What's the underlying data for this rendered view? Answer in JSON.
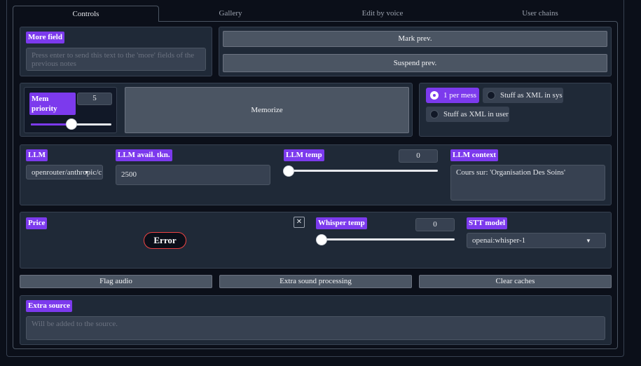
{
  "tabs": [
    "Controls",
    "Gallery",
    "Edit by voice",
    "User chains"
  ],
  "more_field": {
    "label": "More field",
    "placeholder": "Press enter to send this text to the 'more' fields of the previous notes"
  },
  "buttons": {
    "mark_prev": "Mark prev.",
    "suspend_prev": "Suspend prev.",
    "memorize": "Memorize",
    "flag_audio": "Flag audio",
    "extra_sound": "Extra sound processing",
    "clear_caches": "Clear caches"
  },
  "mem_priority": {
    "label": "Mem priority",
    "value": "5",
    "fraction": 0.5
  },
  "message_mode": {
    "options": [
      "1 per mess",
      "Stuff as XML in sys",
      "Stuff as XML in user"
    ],
    "selected": "1 per mess"
  },
  "llm": {
    "label": "LLM",
    "value": "openrouter/anthropic/c"
  },
  "llm_avail": {
    "label": "LLM avail. tkn.",
    "value": "2500"
  },
  "llm_temp": {
    "label": "LLM temp",
    "value": "0",
    "fraction": 0.0
  },
  "llm_context": {
    "label": "LLM context",
    "value": "Cours sur: 'Organisation Des Soins'"
  },
  "price": {
    "label": "Price",
    "status": "Error",
    "close_glyph": "✕"
  },
  "whisper_temp": {
    "label": "Whisper temp",
    "value": "0",
    "fraction": 0.0
  },
  "stt_model": {
    "label": "STT model",
    "value": "openai:whisper-1"
  },
  "extra_source": {
    "label": "Extra source",
    "placeholder": "Will be added to the source."
  },
  "colors": {
    "accent": "#7c3aed",
    "panel": "#1f2937",
    "background": "#0b0f19",
    "error": "#ef4444"
  }
}
